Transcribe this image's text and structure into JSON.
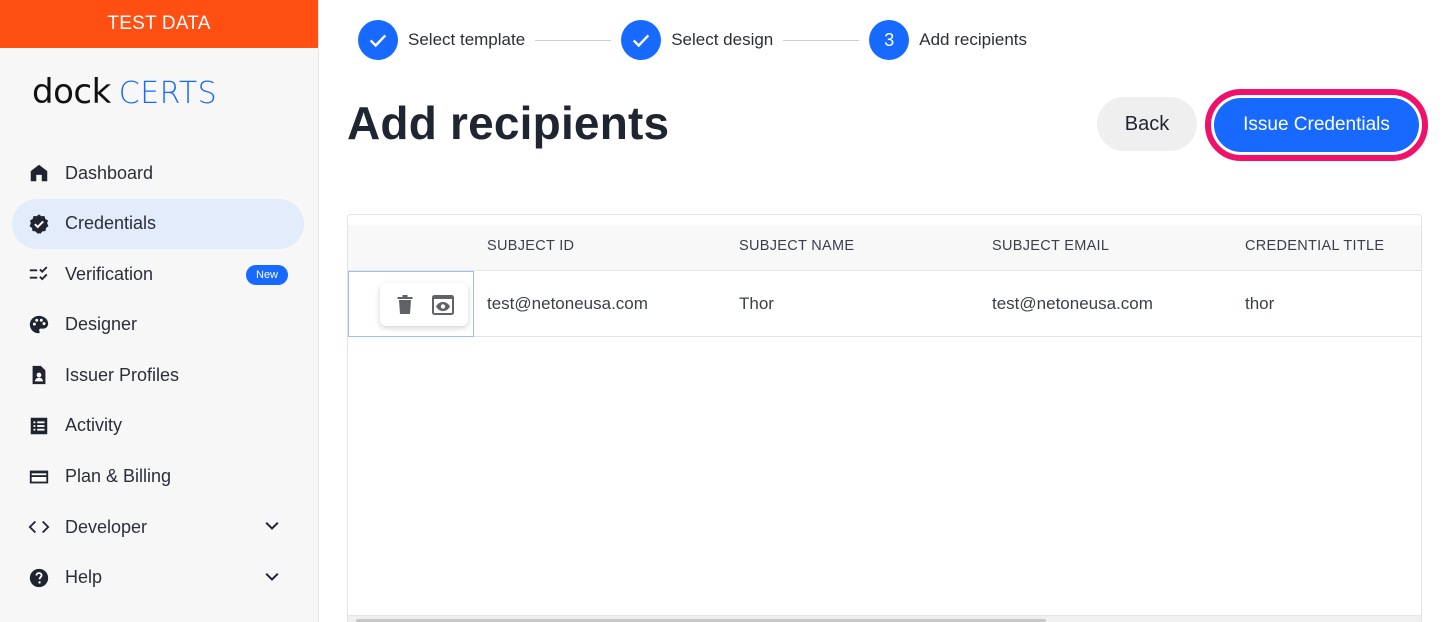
{
  "banner": {
    "text": "TEST DATA",
    "color": "#ff4f12"
  },
  "logo": {
    "part1": "dock",
    "part2": "CERTS"
  },
  "sidebar": {
    "items": [
      {
        "label": "Dashboard",
        "icon": "home-icon"
      },
      {
        "label": "Credentials",
        "icon": "verified-badge-icon",
        "active": true
      },
      {
        "label": "Verification",
        "icon": "checklist-icon",
        "badge": "New"
      },
      {
        "label": "Designer",
        "icon": "palette-icon"
      },
      {
        "label": "Issuer Profiles",
        "icon": "profile-document-icon"
      },
      {
        "label": "Activity",
        "icon": "list-icon"
      },
      {
        "label": "Plan & Billing",
        "icon": "credit-card-icon"
      },
      {
        "label": "Developer",
        "icon": "code-icon",
        "expandable": true
      },
      {
        "label": "Help",
        "icon": "help-icon",
        "expandable": true
      }
    ]
  },
  "stepper": {
    "steps": [
      {
        "label": "Select template",
        "state": "done"
      },
      {
        "label": "Select design",
        "state": "done"
      },
      {
        "label": "Add recipients",
        "state": "current",
        "number": "3"
      }
    ]
  },
  "header": {
    "title": "Add recipients",
    "back_label": "Back",
    "issue_label": "Issue Credentials"
  },
  "table": {
    "columns": [
      "SUBJECT ID",
      "SUBJECT NAME",
      "SUBJECT EMAIL",
      "CREDENTIAL TITLE"
    ],
    "rows": [
      {
        "subject_id": "test@netoneusa.com",
        "subject_name": "Thor",
        "subject_email": "test@netoneusa.com",
        "credential_title": "thor"
      }
    ]
  },
  "colors": {
    "accent": "#1769ff",
    "highlight_ring": "#f0116a",
    "active_nav_bg": "#e3ecfa"
  }
}
